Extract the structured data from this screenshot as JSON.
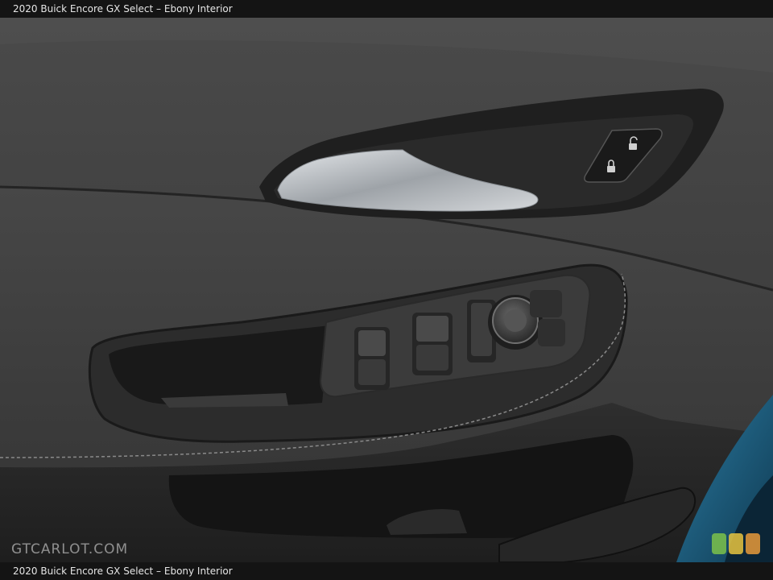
{
  "caption": {
    "top": "2020 Buick Encore GX Select – Ebony Interior",
    "bottom": "2020 Buick Encore GX Select – Ebony Interior"
  },
  "watermark": "GTCARLOT.COM",
  "colors": {
    "door_panel": "#3a3a3a",
    "armrest": "#2b2b2b",
    "handle_chrome": "#c9cdd2",
    "exterior_paint": "#1d5a7a",
    "logo_green": "#7cc24a",
    "logo_yellow": "#e8c440",
    "logo_orange": "#e89a3a"
  },
  "icons": [
    "lock-icon",
    "unlock-icon",
    "window-switch-icon",
    "mirror-control-icon"
  ]
}
